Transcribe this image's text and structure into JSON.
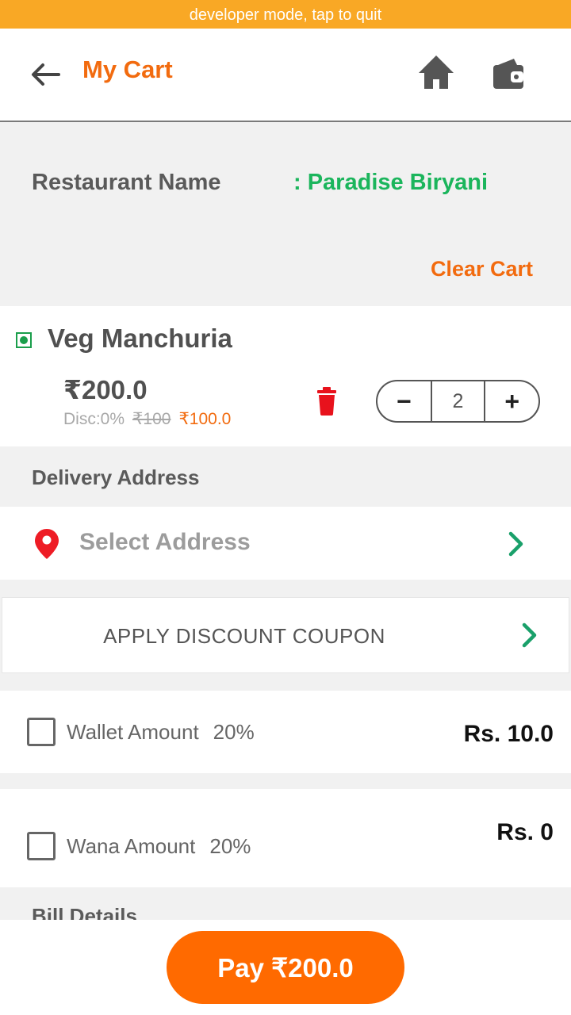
{
  "status_bar": {
    "text": "developer mode, tap to quit"
  },
  "header": {
    "title": "My Cart",
    "back_icon": "arrow-left-icon",
    "home_icon": "home-icon",
    "wallet_icon": "wallet-icon"
  },
  "restaurant": {
    "label": "Restaurant Name",
    "value": ": Paradise Biryani",
    "clear_label": "Clear Cart"
  },
  "cart": {
    "items": [
      {
        "name": "Veg Manchuria",
        "total": "₹200.0",
        "discount": "Disc:0%",
        "original_price": "₹100",
        "unit_price": "₹100.0",
        "quantity": "2"
      }
    ],
    "minus_label": "−",
    "plus_label": "+"
  },
  "delivery": {
    "section_label": "Delivery Address",
    "placeholder": "Select Address"
  },
  "coupon": {
    "label": "APPLY DISCOUNT COUPON"
  },
  "wallet": {
    "label": "Wallet Amount",
    "percent": "20%",
    "amount": "Rs. 10.0",
    "checked": false
  },
  "wana": {
    "label": "Wana Amount",
    "percent": "20%",
    "amount": "Rs. 0",
    "checked": false
  },
  "bill": {
    "section_label": "Bill Details"
  },
  "footer": {
    "pay_label": "Pay ₹200.0"
  },
  "colors": {
    "accent": "#ff6a00",
    "brand_text": "#f26b0f",
    "restaurant_green": "#1bb55c",
    "chevron_green": "#1aa06a",
    "delete_red": "#e8121c",
    "status_bar": "#f9a825"
  }
}
